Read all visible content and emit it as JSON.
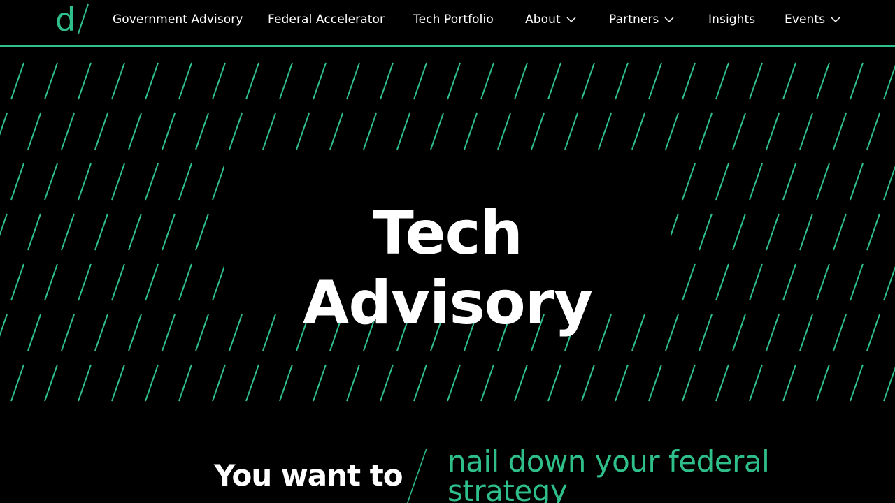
{
  "brand": {
    "logo_letter": "d",
    "accent_color": "#2fbf8a",
    "background_color": "#000000"
  },
  "nav": {
    "items": [
      {
        "label": "Government Advisory",
        "has_dropdown": false
      },
      {
        "label": "Federal Accelerator",
        "has_dropdown": false
      },
      {
        "label": "Tech Portfolio",
        "has_dropdown": false
      },
      {
        "label": "About",
        "has_dropdown": true,
        "icon": "chevron-down-icon"
      },
      {
        "label": "Partners",
        "has_dropdown": true,
        "icon": "chevron-down-icon"
      },
      {
        "label": "Insights",
        "has_dropdown": false
      },
      {
        "label": "Events",
        "has_dropdown": true,
        "icon": "chevron-down-icon"
      }
    ]
  },
  "hero": {
    "title_line1": "Tech",
    "title_line2": "Advisory",
    "pattern": "diagonal-slash-pattern"
  },
  "intro": {
    "lead": "You want to",
    "highlight": "nail down your federal strategy"
  }
}
